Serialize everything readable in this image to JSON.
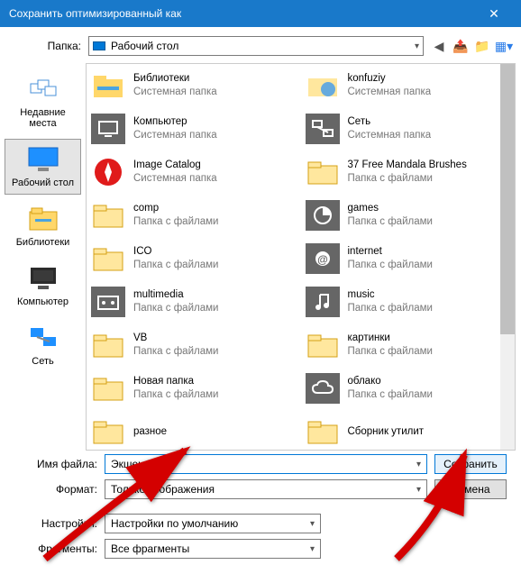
{
  "window": {
    "title": "Сохранить оптимизированный как"
  },
  "folderLabel": "Папка:",
  "folderValue": "Рабочий стол",
  "sidebar": [
    {
      "label": "Недавние места"
    },
    {
      "label": "Рабочий стол"
    },
    {
      "label": "Библиотеки"
    },
    {
      "label": "Компьютер"
    },
    {
      "label": "Сеть"
    }
  ],
  "files": [
    {
      "name": "Библиотеки",
      "sub": "Системная папка",
      "icon": "libraries"
    },
    {
      "name": "konfuziy",
      "sub": "Системная папка",
      "icon": "user"
    },
    {
      "name": "Компьютер",
      "sub": "Системная папка",
      "icon": "computer"
    },
    {
      "name": "Сеть",
      "sub": "Системная папка",
      "icon": "network"
    },
    {
      "name": "Image Catalog",
      "sub": "Системная папка",
      "icon": "imagecatalog"
    },
    {
      "name": "37 Free Mandala Brushes",
      "sub": "Папка с файлами",
      "icon": "folder"
    },
    {
      "name": "comp",
      "sub": "Папка с файлами",
      "icon": "folder"
    },
    {
      "name": "games",
      "sub": "Папка с файлами",
      "icon": "games"
    },
    {
      "name": "ICO",
      "sub": "Папка с файлами",
      "icon": "folder"
    },
    {
      "name": "internet",
      "sub": "Папка с файлами",
      "icon": "internet"
    },
    {
      "name": "multimedia",
      "sub": "Папка с файлами",
      "icon": "multimedia"
    },
    {
      "name": "music",
      "sub": "Папка с файлами",
      "icon": "music"
    },
    {
      "name": "VB",
      "sub": "Папка с файлами",
      "icon": "folder"
    },
    {
      "name": "картинки",
      "sub": "Папка с файлами",
      "icon": "folder"
    },
    {
      "name": "Новая папка",
      "sub": "Папка с файлами",
      "icon": "folder"
    },
    {
      "name": "облако",
      "sub": "Папка с файлами",
      "icon": "cloud"
    },
    {
      "name": "разное",
      "sub": "",
      "icon": "folder"
    },
    {
      "name": "Сборник утилит",
      "sub": "",
      "icon": "folder"
    }
  ],
  "form": {
    "filenameLabel": "Имя файла:",
    "filenameValue": "Экшен.jpg",
    "formatLabel": "Формат:",
    "formatValue": "Только изображения",
    "settingsLabel": "Настройки:",
    "settingsValue": "Настройки по умолчанию",
    "fragmentsLabel": "Фрагменты:",
    "fragmentsValue": "Все фрагменты",
    "saveButton": "Сохранить",
    "cancelButton": "Отмена"
  }
}
